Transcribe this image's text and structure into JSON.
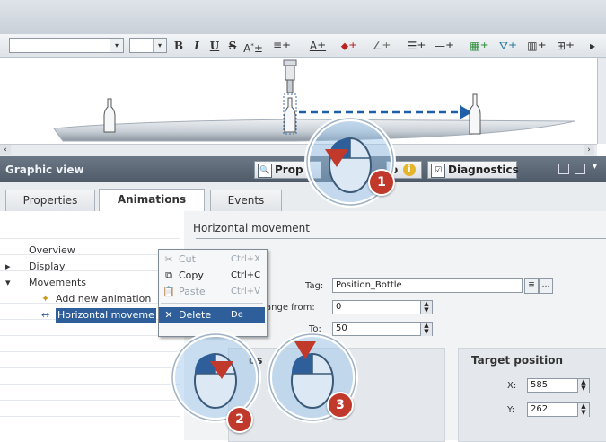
{
  "format_toolbar": {
    "bold": "B",
    "italic": "I",
    "underline": "U",
    "strike": "S"
  },
  "graphic_view": {
    "title": "Graphic view",
    "tabs": [
      {
        "label": "Prop"
      },
      {
        "label": "o"
      },
      {
        "label": "Diagnostics"
      }
    ]
  },
  "inspector_tabs": [
    {
      "label": "Properties"
    },
    {
      "label": "Animations"
    },
    {
      "label": "Events"
    }
  ],
  "tree": {
    "overview": "Overview",
    "display": "Display",
    "movements": "Movements",
    "add_new": "Add new animation",
    "horizontal": "Horizontal moveme"
  },
  "context_menu": {
    "cut": {
      "label": "Cut",
      "shortcut": "Ctrl+X"
    },
    "copy": {
      "label": "Copy",
      "shortcut": "Ctrl+C"
    },
    "paste": {
      "label": "Paste",
      "shortcut": "Ctrl+V"
    },
    "delete": {
      "label": "Delete",
      "shortcut": "De"
    }
  },
  "details": {
    "section_title": "Horizontal movement",
    "tag_label": "Tag:",
    "tag_value": "Position_Bottle",
    "range_from_label": "ange from:",
    "range_from_value": "0",
    "to_label": "To:",
    "to_value": "50",
    "start_group_partial": "os",
    "target_title": "Target position",
    "x_label": "X:",
    "x_value": "585",
    "y_label": "Y:",
    "y_value": "262"
  },
  "callouts": [
    "1",
    "2",
    "3"
  ],
  "colors": {
    "selection": "#2e5f9b",
    "arrow": "#1f5fa8",
    "callout_number": "#c0392b",
    "title_bar": "#5a6674"
  }
}
